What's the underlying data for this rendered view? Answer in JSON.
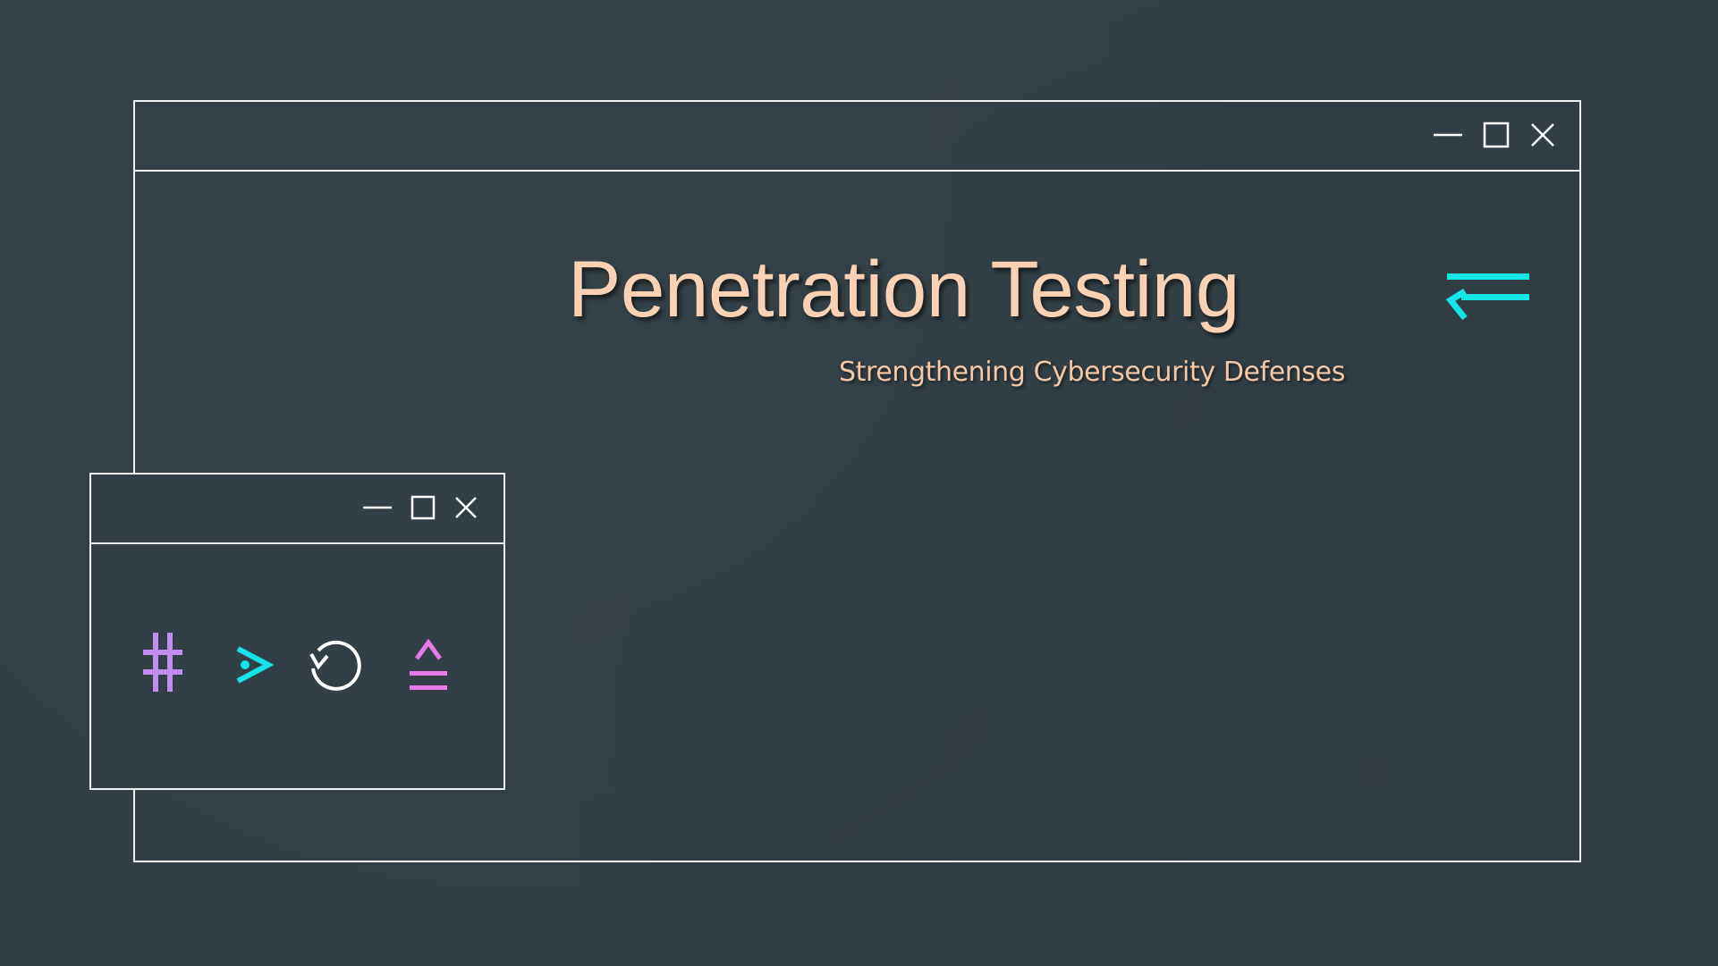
{
  "slide": {
    "title": "Penetration Testing",
    "subtitle": "Strengthening Cybersecurity Defenses"
  },
  "main_window": {
    "controls": [
      "minimize-icon",
      "maximize-icon",
      "close-icon"
    ]
  },
  "small_window": {
    "controls": [
      "minimize-icon",
      "maximize-icon",
      "close-icon"
    ],
    "toolbar_icons": [
      "hash-icon",
      "terminal-prompt-icon",
      "refresh-icon",
      "eject-icon"
    ]
  },
  "decor": {
    "accent_icon": "swap-arrows-icon"
  },
  "colors": {
    "background": "#323f46",
    "frame": "#f2f2f2",
    "title": "#f9d2b6",
    "subtitle": "#f2c8a8",
    "cyan": "#13e6e6",
    "purple": "#c08cf0",
    "magenta": "#e87ae8",
    "white": "#ffffff"
  }
}
